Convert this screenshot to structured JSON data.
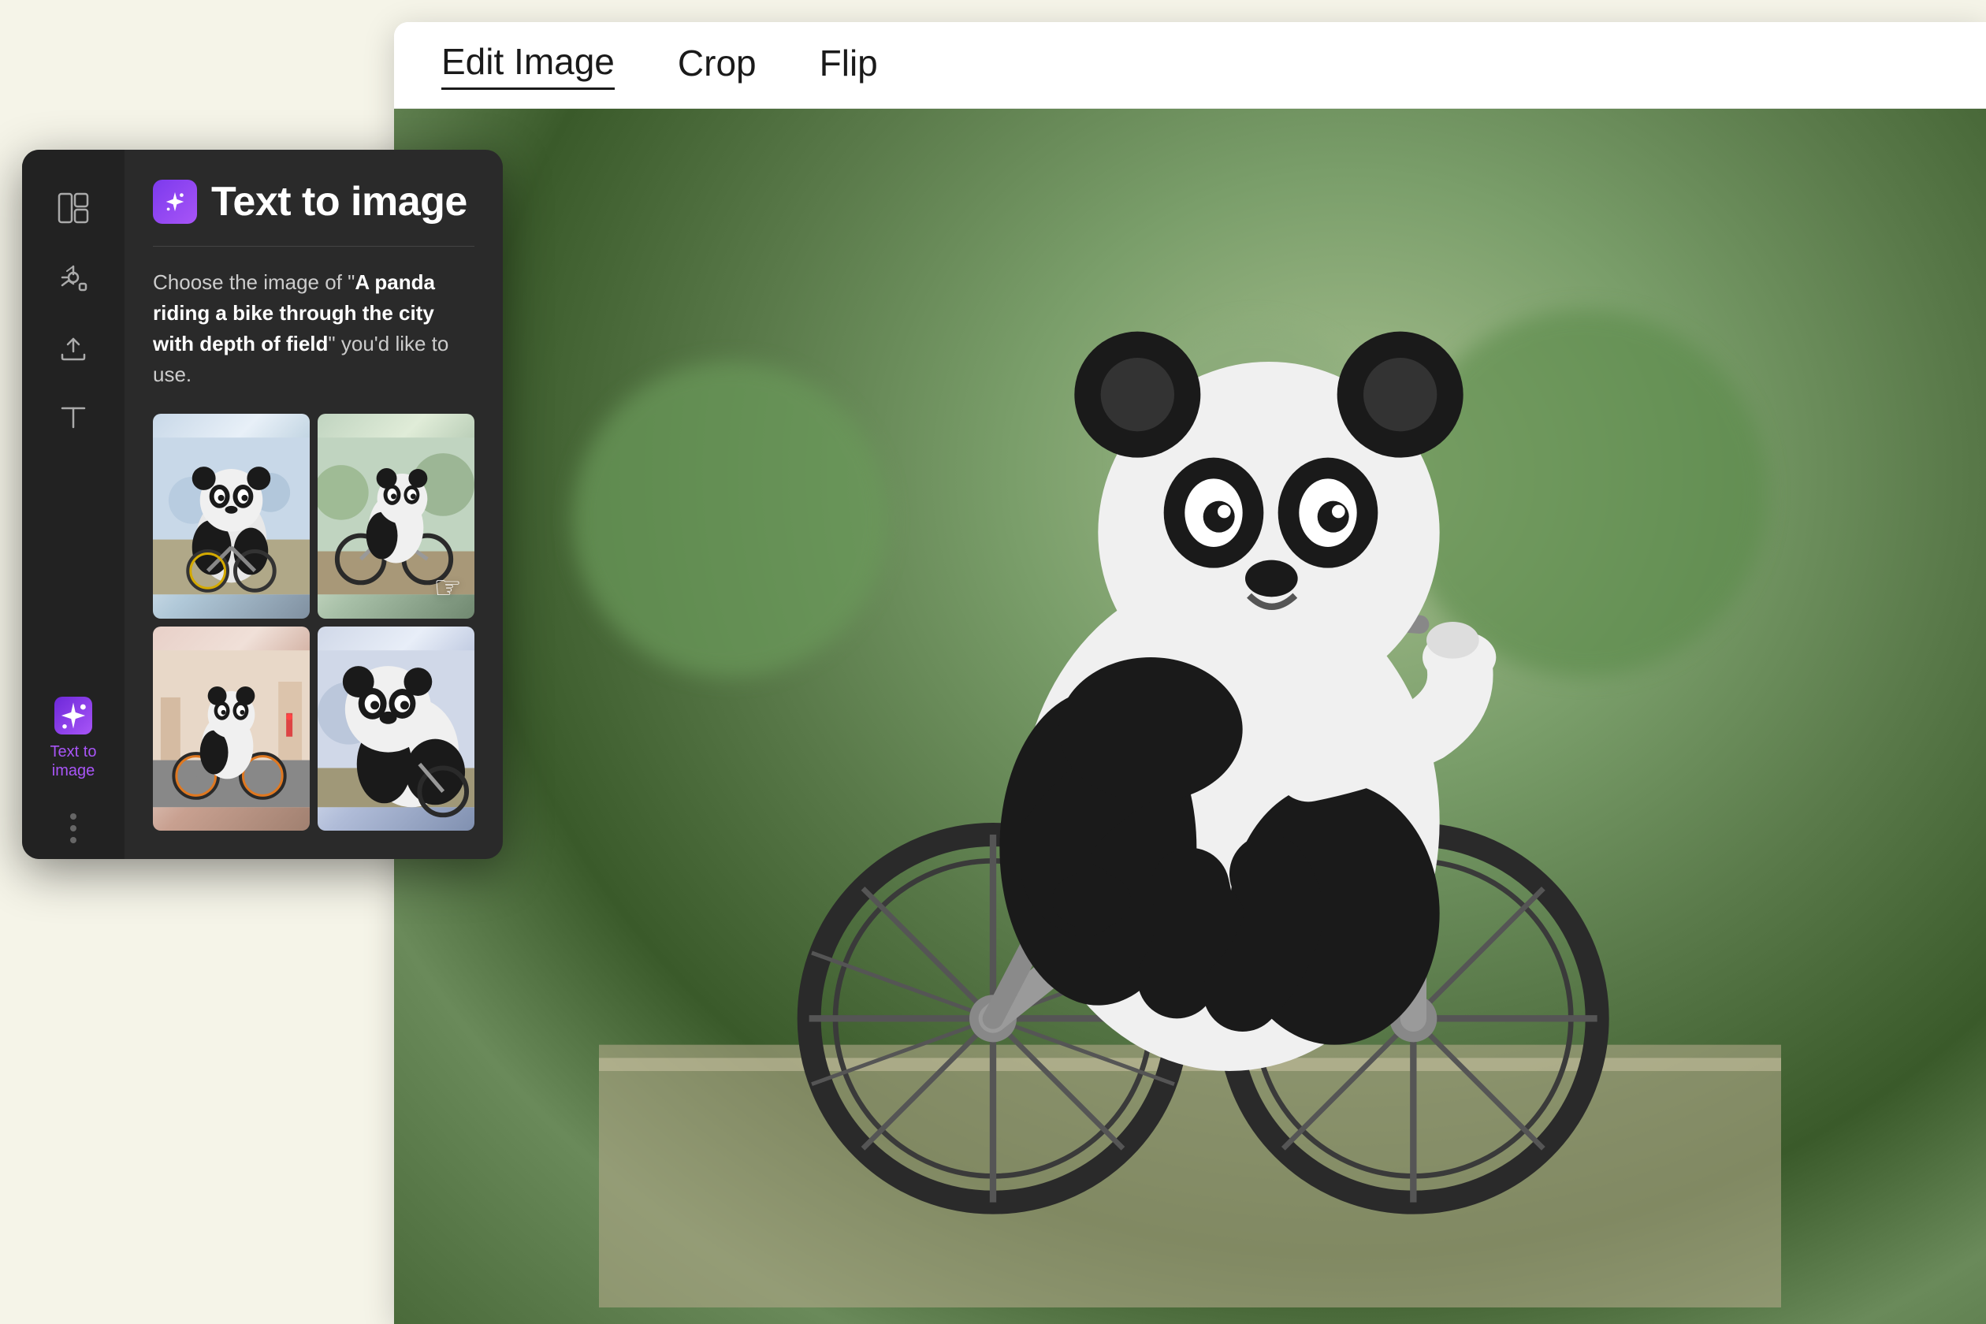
{
  "background_color": "#f5f4e8",
  "toolbar": {
    "items": [
      {
        "label": "Edit Image",
        "active": true
      },
      {
        "label": "Crop",
        "active": false
      },
      {
        "label": "Flip",
        "active": false
      }
    ]
  },
  "sidebar": {
    "icon_rail": [
      {
        "id": "layout",
        "label": "",
        "icon": "layout",
        "active": false
      },
      {
        "id": "elements",
        "label": "",
        "icon": "elements",
        "active": false
      },
      {
        "id": "upload",
        "label": "",
        "icon": "upload",
        "active": false
      },
      {
        "id": "text",
        "label": "",
        "icon": "text",
        "active": false
      },
      {
        "id": "text-to-image",
        "label": "Text to image",
        "icon": "sparkle",
        "active": true
      }
    ],
    "more_label": "•••"
  },
  "panel": {
    "title": "Text to image",
    "icon": "✦",
    "description_prefix": "Choose the image of “",
    "description_bold": "A panda riding a bike through the city with depth of field",
    "description_suffix": "” you’d like to use.",
    "images": [
      {
        "id": 1,
        "alt": "Panda riding bike on city street - frontal view"
      },
      {
        "id": 2,
        "alt": "Panda on bicycle in park - side view",
        "hovered": true
      },
      {
        "id": 3,
        "alt": "Panda cycling in colorful city",
        "hovered": false
      },
      {
        "id": 4,
        "alt": "Panda riding bike - close side view",
        "hovered": false
      }
    ]
  },
  "main_image": {
    "alt": "A panda riding a bike through the city with depth of field - selected large preview"
  }
}
